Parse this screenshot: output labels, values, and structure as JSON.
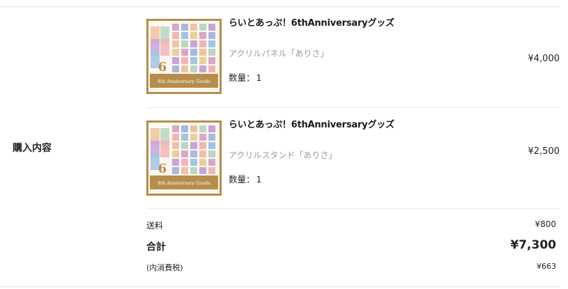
{
  "section": {
    "label": "購入内容"
  },
  "items": [
    {
      "title": "らいとあっぷ！6thAnniversaryグッズ",
      "variant": "アクリルパネル「ありさ」",
      "qty_label": "数量：",
      "qty": "1",
      "price": "¥4,000",
      "thumb_caption": "6th Anniversary Goods",
      "thumb_number": "6"
    },
    {
      "title": "らいとあっぷ！6thAnniversaryグッズ",
      "variant": "アクリルスタンド「ありさ」",
      "qty_label": "数量：",
      "qty": "1",
      "price": "¥2,500",
      "thumb_caption": "6th Anniversary Goods",
      "thumb_number": "6"
    }
  ],
  "summary": {
    "shipping_label": "送料",
    "shipping_value": "¥800",
    "total_label": "合計",
    "total_value": "¥7,300",
    "tax_label": "(内消費税)",
    "tax_value": "¥663"
  },
  "colors": {
    "thumb_border": "#b68d4c",
    "divider": "#e6e6e6"
  }
}
